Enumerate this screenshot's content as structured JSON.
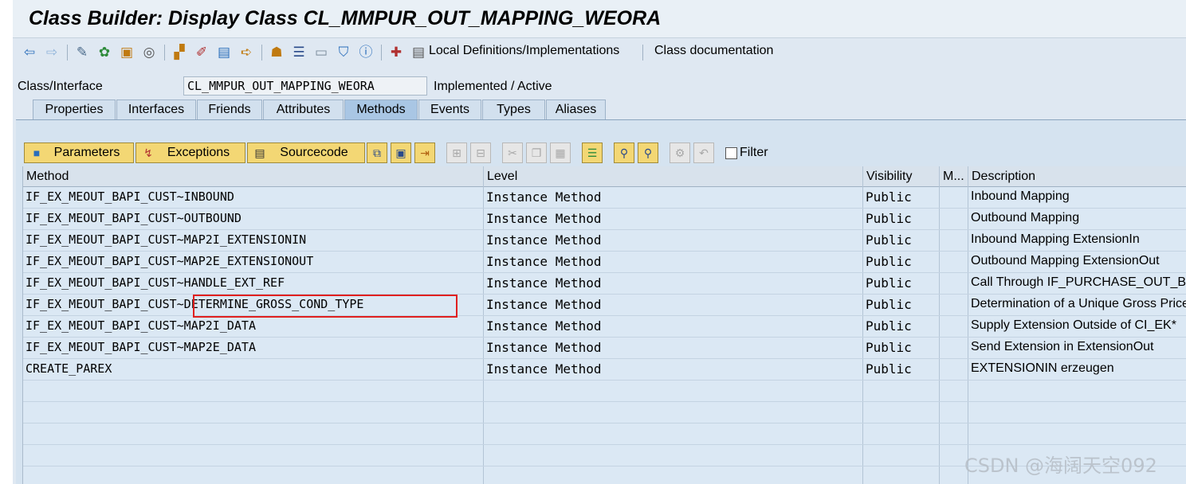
{
  "window": {
    "title": "Class Builder: Display Class CL_MMPUR_OUT_MAPPING_WEORA"
  },
  "toolbar": {
    "icons": [
      "back-icon",
      "forward-icon",
      "other-object-icon",
      "activate-icon",
      "where-used-icon",
      "display-object-list-icon",
      "navigate-icon",
      "edit-icon",
      "insert-icon",
      "test-icon",
      "hierarchy-icon",
      "list-icon",
      "window-icon",
      "filter-icon",
      "info-icon",
      "local-types-icon"
    ],
    "local_definitions_label": "Local Definitions/Implementations",
    "class_documentation_label": "Class documentation"
  },
  "header": {
    "field_label": "Class/Interface",
    "class_name": "CL_MMPUR_OUT_MAPPING_WEORA",
    "status": "Implemented / Active"
  },
  "tabs": [
    {
      "label": "Properties"
    },
    {
      "label": "Interfaces"
    },
    {
      "label": "Friends"
    },
    {
      "label": "Attributes"
    },
    {
      "label": "Methods",
      "active": true
    },
    {
      "label": "Events"
    },
    {
      "label": "Types"
    },
    {
      "label": "Aliases"
    }
  ],
  "methods_toolbar": {
    "parameters_label": "Parameters",
    "exceptions_label": "Exceptions",
    "sourcecode_label": "Sourcecode",
    "filter_label": "Filter"
  },
  "grid": {
    "columns": [
      "Method",
      "Level",
      "Visibility",
      "M...",
      "Description"
    ],
    "rows": [
      {
        "method": "IF_EX_MEOUT_BAPI_CUST~INBOUND",
        "level": "Instance Method",
        "visibility": "Public",
        "description": "Inbound Mapping"
      },
      {
        "method": "IF_EX_MEOUT_BAPI_CUST~OUTBOUND",
        "level": "Instance Method",
        "visibility": "Public",
        "description": "Outbound Mapping"
      },
      {
        "method": "IF_EX_MEOUT_BAPI_CUST~MAP2I_EXTENSIONIN",
        "level": "Instance Method",
        "visibility": "Public",
        "description": "Inbound Mapping ExtensionIn"
      },
      {
        "method": "IF_EX_MEOUT_BAPI_CUST~MAP2E_EXTENSIONOUT",
        "level": "Instance Method",
        "visibility": "Public",
        "description": "Outbound Mapping ExtensionOut"
      },
      {
        "method": "IF_EX_MEOUT_BAPI_CUST~HANDLE_EXT_REF",
        "level": "Instance Method",
        "visibility": "Public",
        "description": "Call Through IF_PURCHASE_OUT_BAPI"
      },
      {
        "method": "IF_EX_MEOUT_BAPI_CUST~DETERMINE_GROSS_COND_TYPE",
        "level": "Instance Method",
        "visibility": "Public",
        "description": "Determination of a Unique Gross Price"
      },
      {
        "method": "IF_EX_MEOUT_BAPI_CUST~MAP2I_DATA",
        "level": "Instance Method",
        "visibility": "Public",
        "description": "Supply Extension Outside of CI_EK*"
      },
      {
        "method": "IF_EX_MEOUT_BAPI_CUST~MAP2E_DATA",
        "level": "Instance Method",
        "visibility": "Public",
        "description": "Send Extension in ExtensionOut"
      },
      {
        "method": "CREATE_PAREX",
        "level": "Instance Method",
        "visibility": "Public",
        "description": "EXTENSIONIN erzeugen"
      }
    ]
  },
  "watermark": "CSDN @海阔天空092",
  "colors": {
    "highlight_border": "#e0201f",
    "button_yellow": "#f3d774",
    "active_tab": "#a9c6e4"
  }
}
